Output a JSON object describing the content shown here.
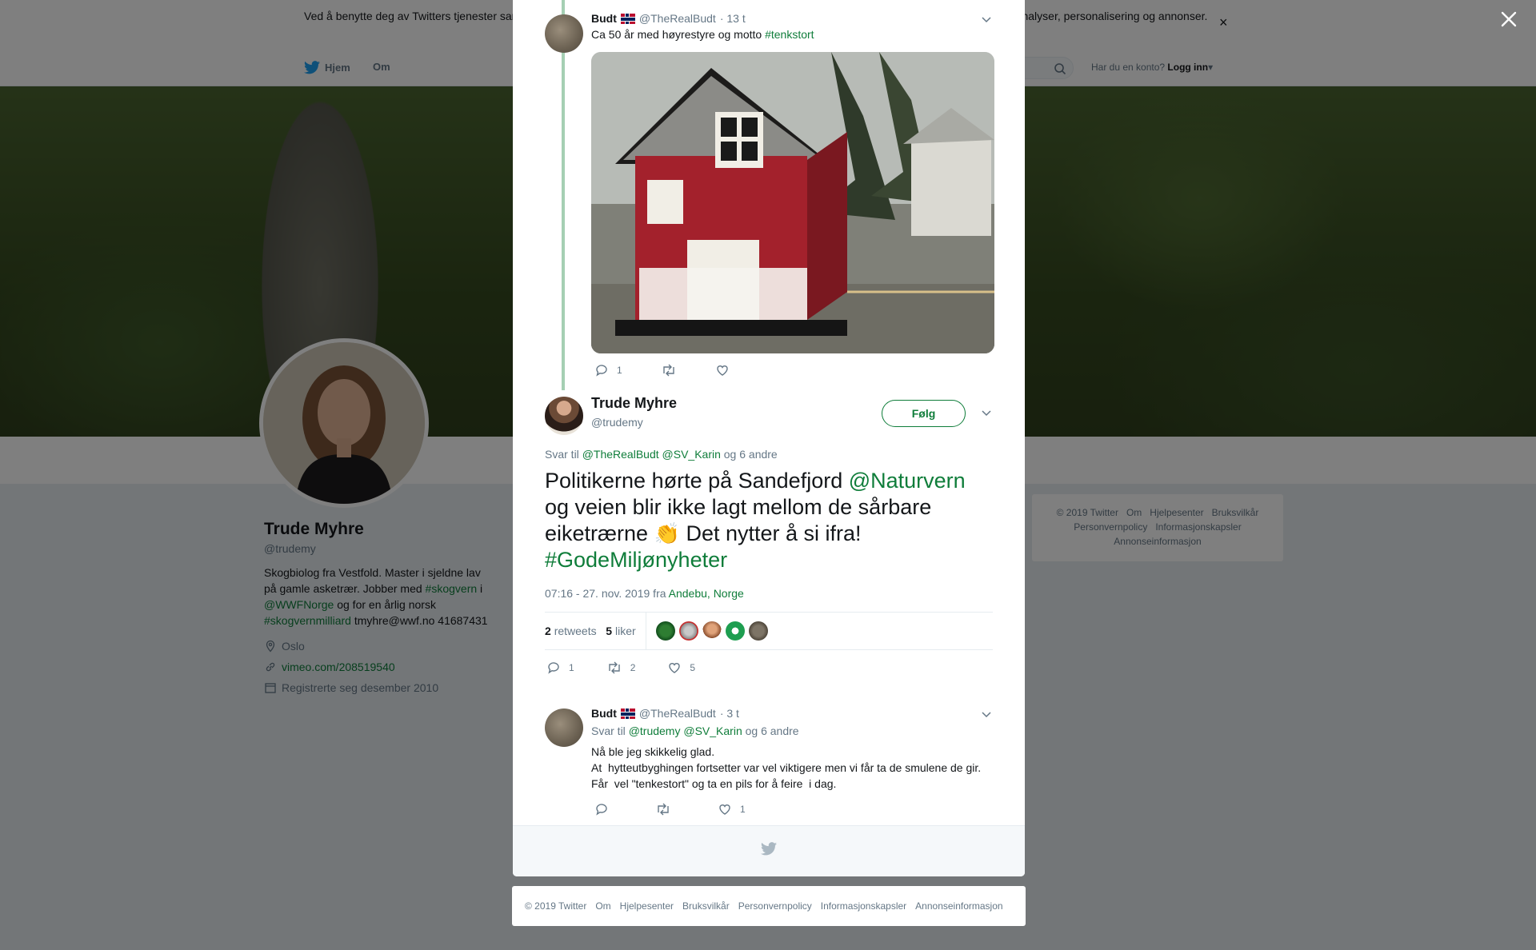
{
  "cookie_bar": {
    "text": "Ved å benytte deg av Twitters tjenester samtykker du til vår bruk av informasjonskapsler. Vi og våre partnere bruker informasjonskapsler til bl.a. analyser, personalisering og annonser."
  },
  "nav": {
    "home": "Hjem",
    "about": "Om",
    "login_prompt": "Har du en konto?",
    "login": "Logg inn"
  },
  "profile": {
    "name": "Trude Myhre",
    "handle": "@trudemy",
    "bio_1": "Skogbiolog fra Vestfold. Master i sjeldne lav på gamle asketrær. Jobber med ",
    "bio_tag_1": "#skogvern",
    "bio_2": " i ",
    "bio_mention": "@WWFNorge",
    "bio_3": " og for en årlig norsk ",
    "bio_tag_2": "#skogvernmilliard",
    "bio_4": " tmyhre@wwf.no 41687431",
    "location": "Oslo",
    "link": "vimeo.com/208519540",
    "joined": "Registrerte seg desember 2010"
  },
  "side_footer": {
    "items": [
      "© 2019 Twitter",
      "Om",
      "Hjelpesenter",
      "Bruksvilkår",
      "Personvernpolicy",
      "Informasjonskapsler",
      "Annonseinformasjon"
    ]
  },
  "tweet_parent": {
    "name": "Budt",
    "handle": "@TheRealBudt",
    "time": "· 13 t",
    "text": "Ca 50 år med høyrestyre og motto ",
    "hashtag": "#tenkstort",
    "reply_count": "1"
  },
  "tweet_main": {
    "name": "Trude Myhre",
    "handle": "@trudemy",
    "follow": "Følg",
    "reply_prefix": "Svar til",
    "reply_mention_1": "@TheRealBudt",
    "reply_mention_2": "@SV_Karin",
    "reply_suffix": "og 6 andre",
    "text_1": "Politikerne hørte på Sandefjord ",
    "mention": "@Naturvern",
    "text_2": " og veien blir ikke lagt mellom de sårbare eiketrærne ",
    "emoji": "👏",
    "text_3": " Det nytter å si ifra!",
    "hashtag": "#GodeMiljønyheter",
    "time": "07:16 - 27. nov. 2019 fra",
    "place": "Andebu, Norge",
    "retweets": "2",
    "retweets_label": "retweets",
    "likes": "5",
    "likes_label": "liker",
    "reply_count": "1",
    "retweet_count": "2",
    "like_count": "5"
  },
  "tweet_reply": {
    "name": "Budt",
    "handle": "@TheRealBudt",
    "time": "· 3 t",
    "reply_prefix": "Svar til",
    "reply_mention_1": "@trudemy",
    "reply_mention_2": "@SV_Karin",
    "reply_suffix": "og 6 andre",
    "line_1": "Nå ble jeg skikkelig glad.",
    "line_2": "At  hytteutbyghingen fortsetter var vel viktigere men vi får ta de smulene de gir.",
    "line_3": "Får  vel \"tenkestort\" og ta en pils for å feire  i dag.",
    "like_count": "1"
  },
  "bottom_footer": {
    "items": [
      "© 2019 Twitter",
      "Om",
      "Hjelpesenter",
      "Bruksvilkår",
      "Personvernpolicy",
      "Informasjonskapsler",
      "Annonseinformasjon"
    ]
  },
  "colors": {
    "accent": "#0f7d3a",
    "thread_line": "#a5cfb3",
    "overlay": "rgba(0,0,0,0.5)"
  }
}
